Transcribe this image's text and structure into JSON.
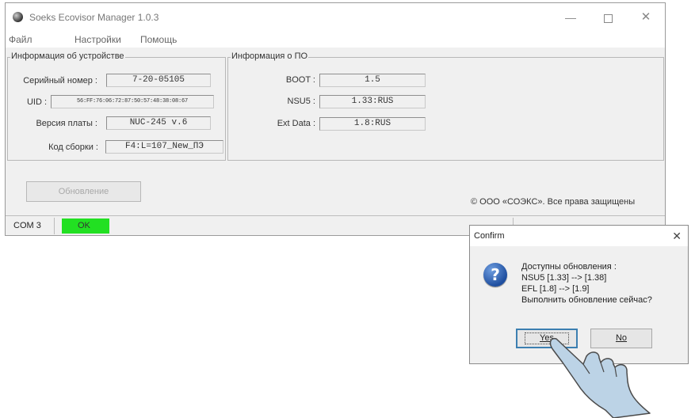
{
  "window": {
    "title": "Soeks Ecovisor Manager 1.0.3",
    "menu": [
      "Файл",
      "Настройки",
      "Помощь"
    ]
  },
  "device_info": {
    "title": "Информация об устройстве",
    "serial_label": "Серийный номер :",
    "serial_value": "7-20-05105",
    "uid_label": "UID :",
    "uid_value": "56:FF:76:06:72:87:50:57:48:38:08:67",
    "board_label": "Версия платы :",
    "board_value": "NUC-245 v.6",
    "build_label": "Код сборки :",
    "build_value": "F4:L=107_New_ПЭ"
  },
  "software_info": {
    "title": "Информация о ПО",
    "boot_label": "BOOT :",
    "boot_value": "1.5",
    "nsu5_label": "NSU5 :",
    "nsu5_value": "1.33:RUS",
    "ext_label": "Ext Data :",
    "ext_value": "1.8:RUS"
  },
  "update_button": "Обновление",
  "copyright": "© ООО «СОЭКС». Все права защищены",
  "status": {
    "port": "COM 3",
    "state": "OK",
    "state_color": "#22e022"
  },
  "dialog": {
    "title": "Confirm",
    "lines": [
      "Доступны обновления :",
      "NSU5 [1.33] --> [1.38]",
      "EFL  [1.8] --> [1.9]",
      "Выполнить обновление сейчас?"
    ],
    "yes_label": "Yes",
    "no_label": "No",
    "icon": "question-icon"
  }
}
